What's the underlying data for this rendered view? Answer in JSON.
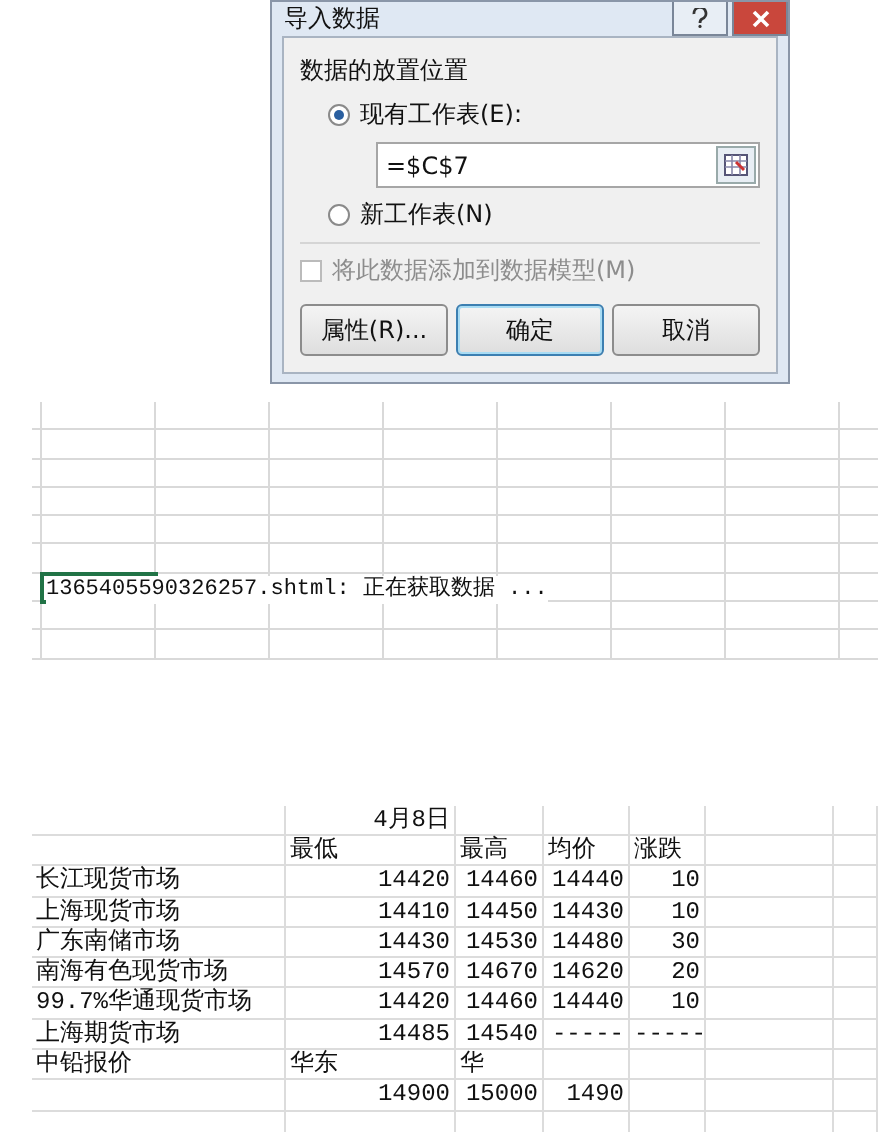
{
  "dialog": {
    "title": "导入数据",
    "group_label": "数据的放置位置",
    "options": [
      {
        "label": "现有工作表(E):",
        "selected": true,
        "kind": "existing"
      },
      {
        "label": "新工作表(N)",
        "selected": false,
        "kind": "new"
      }
    ],
    "reference": {
      "value": "=$C$7"
    },
    "checkbox": {
      "label": "将此数据添加到数据模型(M)",
      "checked": false,
      "disabled": true
    },
    "buttons": [
      {
        "label": "属性(R)...",
        "default": false
      },
      {
        "label": "确定",
        "default": true
      },
      {
        "label": "取消",
        "default": false
      }
    ]
  },
  "sheet": {
    "status_text": "1365405590326257.shtml: 正在获取数据 ..."
  },
  "price_table": {
    "rows": [
      {
        "kind": "values",
        "cells": [
          "4月8日"
        ]
      },
      {
        "kind": "labels",
        "cells": [
          "最低",
          "最高",
          "均价",
          "涨跌"
        ]
      },
      {
        "kind": "values",
        "label": "长江现货市场",
        "cells": [
          "14420",
          "14460",
          "14440",
          "10"
        ]
      },
      {
        "kind": "values",
        "label": "上海现货市场",
        "cells": [
          "14410",
          "14450",
          "14430",
          "10"
        ]
      },
      {
        "kind": "values",
        "label": "广东南储市场",
        "cells": [
          "14430",
          "14530",
          "14480",
          "30"
        ]
      },
      {
        "kind": "values",
        "label": "南海有色现货市场",
        "cells": [
          "14570",
          "14670",
          "14620",
          "20"
        ]
      },
      {
        "kind": "values",
        "label": "99.7%华通现货市场",
        "cells": [
          "14420",
          "14460",
          "14440",
          "10"
        ]
      },
      {
        "kind": "values",
        "label": "上海期货市场",
        "cells": [
          "14485",
          "14540",
          "-----",
          "-----"
        ]
      },
      {
        "kind": "labels",
        "label": "中铅报价",
        "cells": [
          "华东",
          "华"
        ]
      },
      {
        "kind": "values",
        "cells": [
          "14900",
          "15000",
          "1490"
        ]
      }
    ]
  }
}
